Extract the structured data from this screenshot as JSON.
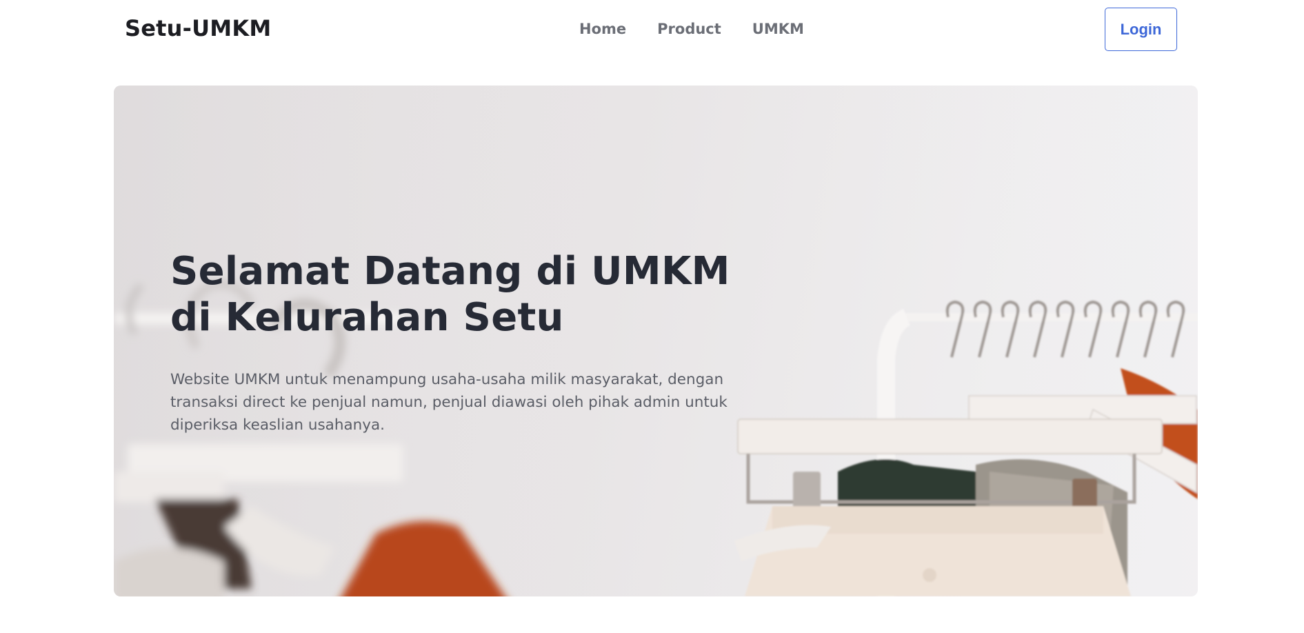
{
  "brand": "Setu-UMKM",
  "nav": {
    "home": "Home",
    "product": "Product",
    "umkm": "UMKM"
  },
  "login_label": "Login",
  "hero": {
    "title_line1": "Selamat Datang di UMKM",
    "title_line2": "di Kelurahan Setu",
    "description": "Website UMKM untuk menampung usaha-usaha milik masyarakat, dengan transaksi direct ke penjual namun, penjual diawasi oleh pihak admin untuk diperiksa keaslian usahanya."
  },
  "colors": {
    "accent": "#3d67d8",
    "title": "#262a35",
    "nav_text": "#6b6e76"
  }
}
